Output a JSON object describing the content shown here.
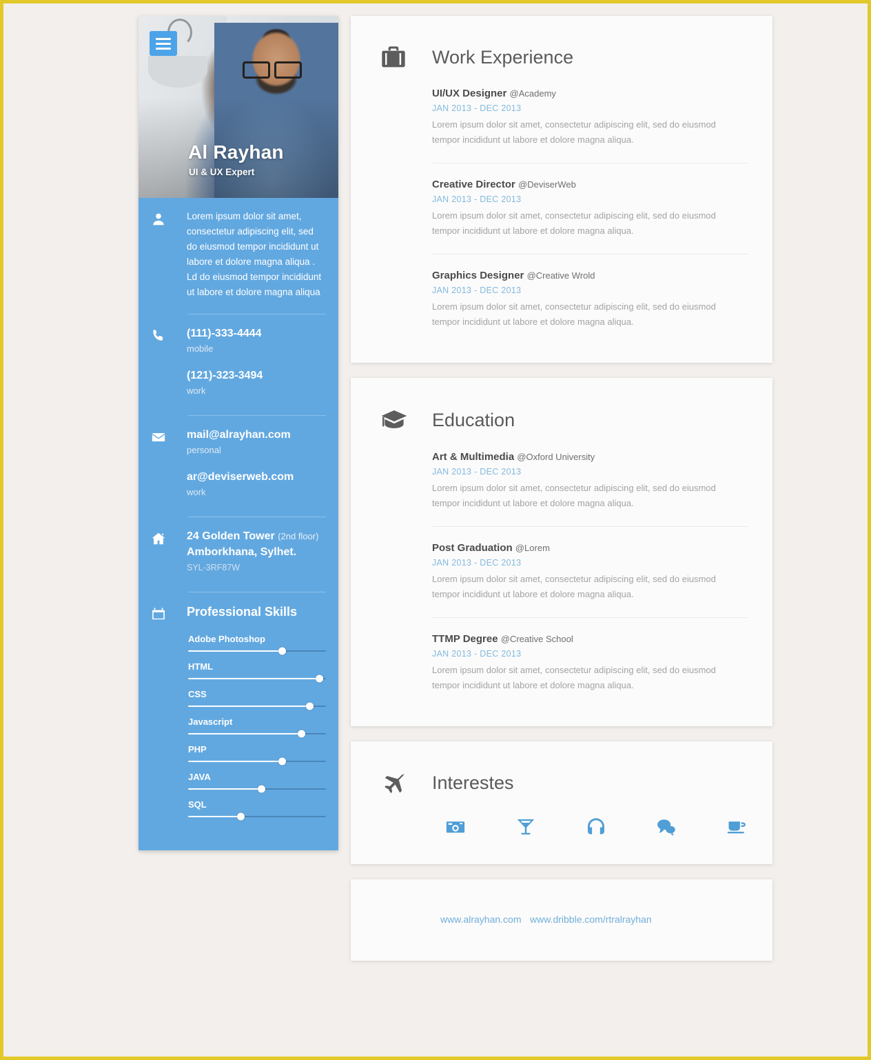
{
  "profile": {
    "name": "Al Rayhan",
    "role": "UI & UX Expert",
    "about": "Lorem ipsum dolor sit amet, consectetur adipiscing elit, sed do eiusmod tempor incididunt ut labore et dolore magna aliqua . Ld do eiusmod tempor incididunt ut labore et dolore magna aliqua"
  },
  "menu": {
    "icon": "hamburger-menu-icon"
  },
  "contact": {
    "phones": [
      {
        "value": "(111)-333-4444",
        "label": "mobile"
      },
      {
        "value": "(121)-323-3494",
        "label": "work"
      }
    ],
    "emails": [
      {
        "value": "mail@alrayhan.com",
        "label": "personal"
      },
      {
        "value": "ar@deviserweb.com",
        "label": "work"
      }
    ],
    "address": {
      "line1": "24 Golden Tower",
      "line1_note": "(2nd floor)",
      "line2": "Amborkhana, Sylhet.",
      "code": "SYL-3RF87W"
    }
  },
  "skills": {
    "title": "Professional Skills",
    "items": [
      {
        "name": "Adobe Photoshop",
        "level": 68
      },
      {
        "name": "HTML",
        "level": 95
      },
      {
        "name": "CSS",
        "level": 88
      },
      {
        "name": "Javascript",
        "level": 82
      },
      {
        "name": "PHP",
        "level": 68
      },
      {
        "name": "JAVA",
        "level": 53
      },
      {
        "name": "SQL",
        "level": 38
      }
    ]
  },
  "work": {
    "title": "Work Experience",
    "icon": "briefcase-icon",
    "entries": [
      {
        "title": "UI/UX Designer",
        "org": "@Academy",
        "date": "JAN 2013 - DEC 2013",
        "desc": "Lorem ipsum dolor sit amet, consectetur adipiscing elit, sed do eiusmod tempor incididunt ut labore et dolore magna aliqua."
      },
      {
        "title": "Creative Director",
        "org": "@DeviserWeb",
        "date": "JAN 2013 - DEC 2013",
        "desc": "Lorem ipsum dolor sit amet, consectetur adipiscing elit, sed do eiusmod tempor incididunt ut labore et dolore magna aliqua."
      },
      {
        "title": "Graphics Designer",
        "org": "@Creative Wrold",
        "date": "JAN 2013 - DEC 2013",
        "desc": "Lorem ipsum dolor sit amet, consectetur adipiscing elit, sed do eiusmod tempor incididunt ut labore et dolore magna aliqua."
      }
    ]
  },
  "education": {
    "title": "Education",
    "icon": "graduation-cap-icon",
    "entries": [
      {
        "title": "Art & Multimedia",
        "org": "@Oxford University",
        "date": "JAN 2013 - DEC 2013",
        "desc": "Lorem ipsum dolor sit amet, consectetur adipiscing elit, sed do eiusmod tempor incididunt ut labore et dolore magna aliqua."
      },
      {
        "title": "Post Graduation",
        "org": "@Lorem",
        "date": "JAN 2013 - DEC 2013",
        "desc": "Lorem ipsum dolor sit amet, consectetur adipiscing elit, sed do eiusmod tempor incididunt ut labore et dolore magna aliqua."
      },
      {
        "title": "TTMP Degree",
        "org": "@Creative School",
        "date": "JAN 2013 - DEC 2013",
        "desc": "Lorem ipsum dolor sit amet, consectetur adipiscing elit, sed do eiusmod tempor incididunt ut labore et dolore magna aliqua."
      }
    ]
  },
  "interests": {
    "title": "Interestes",
    "icon": "airplane-icon",
    "items": [
      "camera-icon",
      "cocktail-glass-icon",
      "headphones-icon",
      "chat-bubbles-icon",
      "coffee-cup-icon"
    ]
  },
  "links": [
    {
      "text": "www.alrayhan.com"
    },
    {
      "text": "www.dribble.com/rtralrayhan"
    }
  ],
  "colors": {
    "sidebar_blue": "#62a8e0",
    "accent_blue": "#4f9ed6",
    "date_blue": "#83b9dd",
    "page_border": "#e3c82a",
    "page_bg": "#f2efec"
  }
}
